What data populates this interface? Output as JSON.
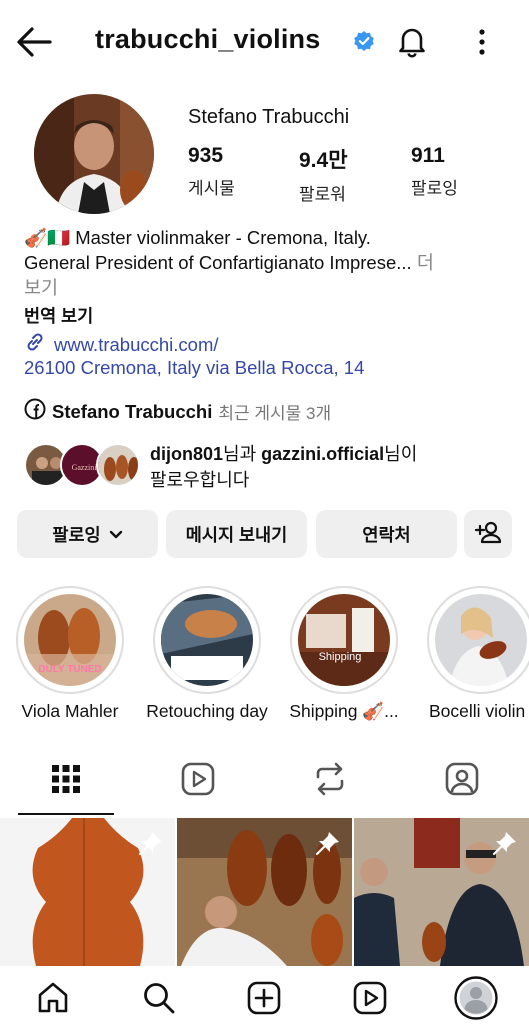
{
  "header": {
    "username": "trabucchi_violins"
  },
  "profile": {
    "full_name": "Stefano Trabucchi",
    "stats": [
      {
        "value": "935",
        "label": "게시물"
      },
      {
        "value": "9.4만",
        "label": "팔로워"
      },
      {
        "value": "911",
        "label": "팔로잉"
      }
    ],
    "bio_line1": "🎻🇮🇹 Master violinmaker - Cremona, Italy.",
    "bio_line2": "General President of Confartigianato Imprese...",
    "bio_more1": " 더",
    "bio_more2": "보기",
    "translate": "번역 보기",
    "website": "www.trabucchi.com/",
    "address": "26100 Cremona, Italy via Bella Rocca, 14",
    "facebook_name": "Stefano Trabucchi",
    "facebook_recent": "최근 게시물 3개"
  },
  "followed_by": {
    "user1": "dijon801",
    "conj1": "님과 ",
    "user2": "gazzini.official",
    "conj2": "님이",
    "line2": "팔로우합니다",
    "mini_label": "Gazzini"
  },
  "actions": {
    "following": "팔로잉",
    "message": "메시지 보내기",
    "contact": "연락처"
  },
  "highlights": [
    {
      "label": "Viola Mahler",
      "overlay": "DULY TUNED"
    },
    {
      "label": "Retouching day",
      "overlay": ""
    },
    {
      "label": "Shipping 🎻...",
      "overlay": "Shipping"
    },
    {
      "label": "Bocelli violin",
      "overlay": ""
    }
  ],
  "colors": {
    "link": "#3548a8",
    "verified": "#3897f0",
    "button_bg": "#efefef"
  }
}
